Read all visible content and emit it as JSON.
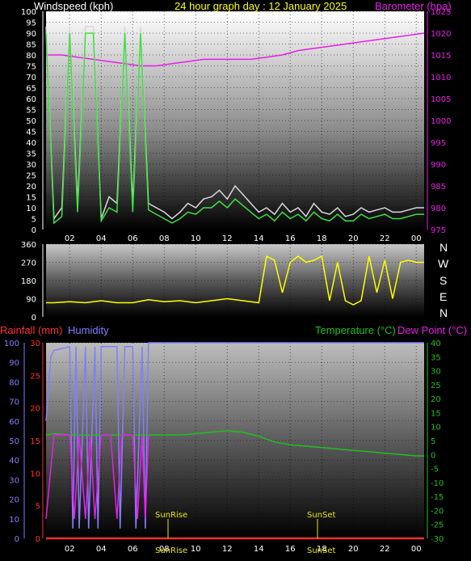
{
  "title": "24 hour graph day : 12 January 2025",
  "colors": {
    "background": "#000000",
    "wind": "#3fe03f",
    "gust": "#d8d8d8",
    "barometer": "#e81ee8",
    "direction": "#ffff00",
    "rain": "#ff3030",
    "humidity": "#8080ff",
    "temperature": "#20c020",
    "dewpoint": "#e81ee8",
    "title": "#ffff00",
    "sun": "#e8e800"
  },
  "x_tick_labels": [
    "02",
    "04",
    "06",
    "08",
    "10",
    "12",
    "14",
    "16",
    "18",
    "20",
    "22",
    "00"
  ],
  "compass": [
    "N",
    "W",
    "S",
    "E",
    "N"
  ],
  "panel_labels": {
    "wind": "Windspeed (kph)",
    "barometer": "Barometer (hpa)",
    "rain": "Rainfall (mm)",
    "humidity": "Humidity",
    "temperature": "Temperature (°C)",
    "dewpoint": "Dew Point (°C)",
    "sunrise": "SunRise",
    "sunset": "SunSet",
    "sunrise_axis": "SunRise",
    "sunset_axis": "SunSet"
  },
  "chart_data": [
    {
      "type": "line",
      "panel": "wind-barometer",
      "x_unit": "hours",
      "xlim": [
        0.5,
        24.5
      ],
      "y_left_label": "Windspeed (kph)",
      "y_left_ticks": [
        0,
        5,
        10,
        15,
        20,
        25,
        30,
        35,
        40,
        45,
        50,
        55,
        60,
        65,
        70,
        75,
        80,
        85,
        90,
        95,
        100
      ],
      "y_right_label": "Barometer (hpa)",
      "y_right_ticks": [
        975,
        980,
        985,
        990,
        995,
        1000,
        1005,
        1010,
        1015,
        1020,
        1025
      ],
      "series": [
        {
          "name": "Barometer (hpa)",
          "axis": "right",
          "x": [
            0.5,
            1.5,
            2.5,
            3.5,
            4.5,
            5.5,
            6.5,
            7.5,
            8.5,
            9.5,
            10.5,
            11.5,
            12.5,
            13.5,
            14.5,
            15.5,
            16.5,
            17.5,
            18.5,
            19.5,
            20.5,
            21.5,
            22.5,
            23.5,
            24.5
          ],
          "values": [
            1015,
            1015,
            1014.5,
            1014,
            1013.5,
            1013,
            1012.5,
            1012.5,
            1013,
            1013.5,
            1014,
            1014,
            1014,
            1014,
            1014.5,
            1015,
            1016,
            1016.5,
            1017,
            1017.5,
            1018,
            1018.5,
            1019,
            1019.5,
            1020
          ]
        },
        {
          "name": "Wind gust",
          "axis": "left",
          "x": [
            0.5,
            1,
            1.5,
            2,
            2.5,
            3,
            3.5,
            4,
            4.5,
            5,
            5.5,
            6,
            6.5,
            7,
            7.5,
            8,
            8.5,
            9,
            9.5,
            10,
            10.5,
            11,
            11.5,
            12,
            12.5,
            13,
            13.5,
            14,
            14.5,
            15,
            15.5,
            16,
            16.5,
            17,
            17.5,
            18,
            18.5,
            19,
            19.5,
            20,
            20.5,
            21,
            21.5,
            22,
            22.5,
            23,
            23.5,
            24,
            24.5
          ],
          "values": [
            93,
            5,
            10,
            93,
            12,
            93,
            93,
            5,
            15,
            12,
            93,
            12,
            93,
            12,
            10,
            8,
            5,
            8,
            12,
            10,
            14,
            15,
            18,
            14,
            20,
            16,
            12,
            8,
            10,
            7,
            12,
            8,
            10,
            6,
            12,
            8,
            7,
            10,
            6,
            7,
            10,
            8,
            9,
            10,
            8,
            8,
            9,
            10,
            10
          ]
        },
        {
          "name": "Wind speed",
          "axis": "left",
          "x": [
            0.5,
            1,
            1.5,
            2,
            2.5,
            3,
            3.5,
            4,
            4.5,
            5,
            5.5,
            6,
            6.5,
            7,
            7.5,
            8,
            8.5,
            9,
            9.5,
            10,
            10.5,
            11,
            11.5,
            12,
            12.5,
            13,
            13.5,
            14,
            14.5,
            15,
            15.5,
            16,
            16.5,
            17,
            17.5,
            18,
            18.5,
            19,
            19.5,
            20,
            20.5,
            21,
            21.5,
            22,
            22.5,
            23,
            23.5,
            24,
            24.5
          ],
          "values": [
            90,
            3,
            6,
            90,
            8,
            90,
            90,
            4,
            10,
            8,
            90,
            8,
            90,
            9,
            7,
            5,
            3,
            5,
            8,
            7,
            10,
            10,
            13,
            10,
            14,
            11,
            8,
            5,
            7,
            4,
            8,
            5,
            7,
            4,
            8,
            5,
            4,
            7,
            4,
            4,
            7,
            5,
            6,
            7,
            5,
            5,
            6,
            7,
            7
          ]
        }
      ]
    },
    {
      "type": "line",
      "panel": "wind-direction",
      "x_unit": "hours",
      "xlim": [
        0.5,
        24.5
      ],
      "y_label": "",
      "y_ticks": [
        0,
        90,
        180,
        270,
        360
      ],
      "series": [
        {
          "name": "Wind direction",
          "x": [
            0.5,
            1,
            2,
            3,
            4,
            5,
            6,
            7,
            8,
            9,
            10,
            11,
            12,
            13,
            14,
            14.5,
            15,
            15.5,
            16,
            16.5,
            17,
            17.5,
            18,
            18.5,
            19,
            19.5,
            20,
            20.5,
            21,
            21.5,
            22,
            22.5,
            23,
            23.5,
            24,
            24.5
          ],
          "values": [
            70,
            70,
            75,
            70,
            80,
            70,
            70,
            85,
            75,
            80,
            70,
            80,
            90,
            80,
            70,
            300,
            280,
            120,
            270,
            300,
            270,
            280,
            300,
            80,
            270,
            80,
            60,
            80,
            300,
            120,
            280,
            90,
            270,
            280,
            270,
            270
          ]
        }
      ]
    },
    {
      "type": "line",
      "panel": "rain-humidity-temperature",
      "x_unit": "hours",
      "xlim": [
        0.5,
        24.5
      ],
      "y_left_label": "Rainfall (mm)",
      "y_left_ticks": [
        0,
        5,
        10,
        15,
        20,
        25,
        30
      ],
      "y_humidity_label": "Humidity",
      "y_humidity_ticks": [
        0,
        10,
        20,
        30,
        40,
        50,
        60,
        70,
        80,
        90,
        100
      ],
      "y_right_label": "Temperature (°C)",
      "y_right_ticks": [
        -30,
        -25,
        -20,
        -15,
        -10,
        -5,
        0,
        5,
        10,
        15,
        20,
        25,
        30,
        35,
        40
      ],
      "annotations": [
        {
          "label": "SunRise",
          "x": 8.1
        },
        {
          "label": "SunSet",
          "x": 16.7
        }
      ],
      "series": [
        {
          "name": "Rainfall (mm)",
          "axis": "left",
          "x": [
            0.5,
            24.5
          ],
          "values": [
            0,
            0
          ]
        },
        {
          "name": "Humidity",
          "axis": "humidity",
          "x": [
            0.5,
            0.8,
            1,
            2,
            2.2,
            2.4,
            2.6,
            3,
            3.2,
            3.6,
            3.8,
            4,
            5,
            5.2,
            5.5,
            6,
            6.2,
            6.6,
            6.8,
            7,
            8,
            9,
            10,
            12,
            14,
            16,
            18,
            20,
            22,
            24,
            24.5
          ],
          "values": [
            60,
            93,
            96,
            98,
            5,
            98,
            5,
            98,
            5,
            98,
            5,
            98,
            98,
            5,
            98,
            98,
            5,
            98,
            5,
            100,
            100,
            100,
            100,
            100,
            100,
            100,
            100,
            100,
            100,
            100,
            100
          ]
        },
        {
          "name": "Temperature (°C)",
          "axis": "right",
          "x": [
            0.5,
            1,
            2,
            3,
            4,
            5,
            6,
            7,
            8,
            9,
            10,
            11,
            12,
            13,
            14,
            15,
            16,
            17,
            18,
            19,
            20,
            21,
            22,
            23,
            24,
            24.5
          ],
          "values": [
            7,
            7.5,
            7,
            7,
            7,
            7,
            7,
            7,
            7,
            7,
            7.5,
            8,
            8.5,
            8,
            6.5,
            4.5,
            3.5,
            3,
            2.5,
            2,
            1.5,
            1,
            0.5,
            0,
            -0.5,
            -0.5
          ]
        },
        {
          "name": "Dew Point (°C)",
          "axis": "right",
          "x": [
            0.5,
            1,
            1.5,
            2,
            2.3,
            2.6,
            3,
            3.3,
            3.6,
            4,
            4.3,
            4.6,
            5,
            5.3,
            5.6,
            6,
            6.3,
            6.6,
            6.8,
            7
          ],
          "values": [
            -23,
            7,
            7,
            7,
            -23,
            7,
            -23,
            7,
            -23,
            7,
            7,
            7,
            -23,
            7,
            7,
            7,
            -23,
            7,
            -23,
            7
          ]
        }
      ]
    }
  ]
}
